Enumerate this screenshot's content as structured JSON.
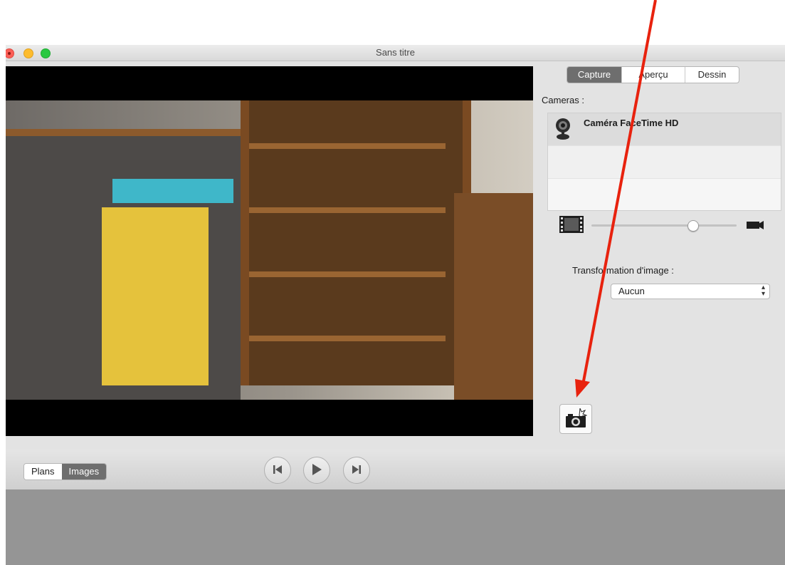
{
  "window": {
    "title": "Sans titre"
  },
  "mode_tabs": [
    {
      "label": "Capture",
      "active": true
    },
    {
      "label": "Aperçu",
      "active": false
    },
    {
      "label": "Dessin",
      "active": false
    }
  ],
  "cameras": {
    "label": "Cameras :",
    "items": [
      {
        "name": "Caméra FaceTime HD",
        "icon": "webcam-icon",
        "selected": true
      }
    ]
  },
  "zoom_slider": {
    "level": 0.7,
    "left_icon": "film-icon",
    "right_icon": "movie-camera-icon"
  },
  "transform": {
    "label": "Transformation d'image :",
    "selected": "Aucun"
  },
  "capture_button": {
    "icon": "camera-icon"
  },
  "bottom_tabs": [
    {
      "label": "Plans",
      "active": false
    },
    {
      "label": "Images",
      "active": true
    }
  ],
  "playback": [
    {
      "icon": "skip-back-icon"
    },
    {
      "icon": "play-icon"
    },
    {
      "icon": "skip-forward-icon"
    }
  ],
  "annotation": {
    "arrow_color": "#e8220e"
  }
}
